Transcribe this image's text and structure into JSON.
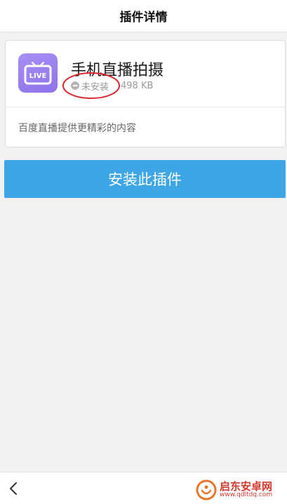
{
  "header": {
    "title": "插件详情"
  },
  "plugin": {
    "name": "手机直播拍摄",
    "icon": "live-tv-icon",
    "icon_label": "LIVE",
    "status": "未安装",
    "status_icon": "minus-circle-icon",
    "size": "498 KB",
    "description": "百度直播提供更精彩的内容"
  },
  "actions": {
    "install_label": "安装此插件"
  },
  "bottom_bar": {
    "back_icon": "chevron-left-icon"
  },
  "watermark": {
    "name": "启东安卓网",
    "url": "www.qdltdq.com"
  },
  "colors": {
    "accent": "#3ea6e6",
    "icon_bg": "#9b80f0",
    "annotation": "#d9262c",
    "watermark": "#d23b2b"
  }
}
